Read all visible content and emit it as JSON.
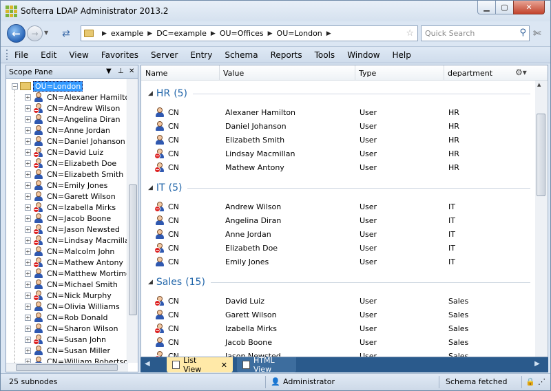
{
  "window": {
    "title": "Softerra LDAP Administrator 2013.2"
  },
  "address": {
    "crumbs": [
      "example",
      "DC=example",
      "OU=Offices",
      "OU=London"
    ]
  },
  "search": {
    "placeholder": "Quick Search"
  },
  "menu": [
    "File",
    "Edit",
    "View",
    "Favorites",
    "Server",
    "Entry",
    "Schema",
    "Reports",
    "Tools",
    "Window",
    "Help"
  ],
  "scope": {
    "title": "Scope Pane",
    "root": "OU=London",
    "nodes": [
      {
        "label": "CN=Alexaner Hamilton",
        "disabled": false
      },
      {
        "label": "CN=Andrew Wilson",
        "disabled": true
      },
      {
        "label": "CN=Angelina Diran",
        "disabled": false
      },
      {
        "label": "CN=Anne Jordan",
        "disabled": false
      },
      {
        "label": "CN=Daniel Johanson",
        "disabled": false
      },
      {
        "label": "CN=David Luiz",
        "disabled": true
      },
      {
        "label": "CN=Elizabeth Doe",
        "disabled": true
      },
      {
        "label": "CN=Elizabeth Smith",
        "disabled": false
      },
      {
        "label": "CN=Emily Jones",
        "disabled": false
      },
      {
        "label": "CN=Garett Wilson",
        "disabled": false
      },
      {
        "label": "CN=Izabella Mirks",
        "disabled": true
      },
      {
        "label": "CN=Jacob Boone",
        "disabled": false
      },
      {
        "label": "CN=Jason Newsted",
        "disabled": true
      },
      {
        "label": "CN=Lindsay Macmillan",
        "disabled": true
      },
      {
        "label": "CN=Malcolm John",
        "disabled": false
      },
      {
        "label": "CN=Mathew Antony",
        "disabled": true
      },
      {
        "label": "CN=Matthew Mortimer",
        "disabled": false
      },
      {
        "label": "CN=Michael Smith",
        "disabled": false
      },
      {
        "label": "CN=Nick Murphy",
        "disabled": true
      },
      {
        "label": "CN=Olivia Williams",
        "disabled": false
      },
      {
        "label": "CN=Rob Donald",
        "disabled": false
      },
      {
        "label": "CN=Sharon Wilson",
        "disabled": false
      },
      {
        "label": "CN=Susan John",
        "disabled": true
      },
      {
        "label": "CN=Susan Miller",
        "disabled": false
      },
      {
        "label": "CN=William Robertson",
        "disabled": false
      }
    ]
  },
  "list": {
    "columns": [
      "Name",
      "Value",
      "Type",
      "department"
    ],
    "groups": [
      {
        "title": "HR",
        "count": "(5)",
        "rows": [
          {
            "name": "CN",
            "value": "Alexaner Hamilton",
            "type": "User",
            "dept": "HR",
            "disabled": false
          },
          {
            "name": "CN",
            "value": "Daniel Johanson",
            "type": "User",
            "dept": "HR",
            "disabled": false
          },
          {
            "name": "CN",
            "value": "Elizabeth Smith",
            "type": "User",
            "dept": "HR",
            "disabled": false
          },
          {
            "name": "CN",
            "value": "Lindsay Macmillan",
            "type": "User",
            "dept": "HR",
            "disabled": true
          },
          {
            "name": "CN",
            "value": "Mathew Antony",
            "type": "User",
            "dept": "HR",
            "disabled": true
          }
        ]
      },
      {
        "title": "IT",
        "count": "(5)",
        "rows": [
          {
            "name": "CN",
            "value": "Andrew Wilson",
            "type": "User",
            "dept": "IT",
            "disabled": true
          },
          {
            "name": "CN",
            "value": "Angelina Diran",
            "type": "User",
            "dept": "IT",
            "disabled": false
          },
          {
            "name": "CN",
            "value": "Anne Jordan",
            "type": "User",
            "dept": "IT",
            "disabled": false
          },
          {
            "name": "CN",
            "value": "Elizabeth Doe",
            "type": "User",
            "dept": "IT",
            "disabled": true
          },
          {
            "name": "CN",
            "value": "Emily Jones",
            "type": "User",
            "dept": "IT",
            "disabled": false
          }
        ]
      },
      {
        "title": "Sales",
        "count": "(15)",
        "rows": [
          {
            "name": "CN",
            "value": "David Luiz",
            "type": "User",
            "dept": "Sales",
            "disabled": true
          },
          {
            "name": "CN",
            "value": "Garett Wilson",
            "type": "User",
            "dept": "Sales",
            "disabled": false
          },
          {
            "name": "CN",
            "value": "Izabella Mirks",
            "type": "User",
            "dept": "Sales",
            "disabled": true
          },
          {
            "name": "CN",
            "value": "Jacob Boone",
            "type": "User",
            "dept": "Sales",
            "disabled": false
          },
          {
            "name": "CN",
            "value": "Jason Newsted",
            "type": "User",
            "dept": "Sales",
            "disabled": true
          }
        ]
      }
    ]
  },
  "tabs": {
    "list_view": "List View",
    "html_view": "HTML View"
  },
  "status": {
    "subnodes": "25 subnodes",
    "user": "Administrator",
    "schema": "Schema fetched"
  }
}
